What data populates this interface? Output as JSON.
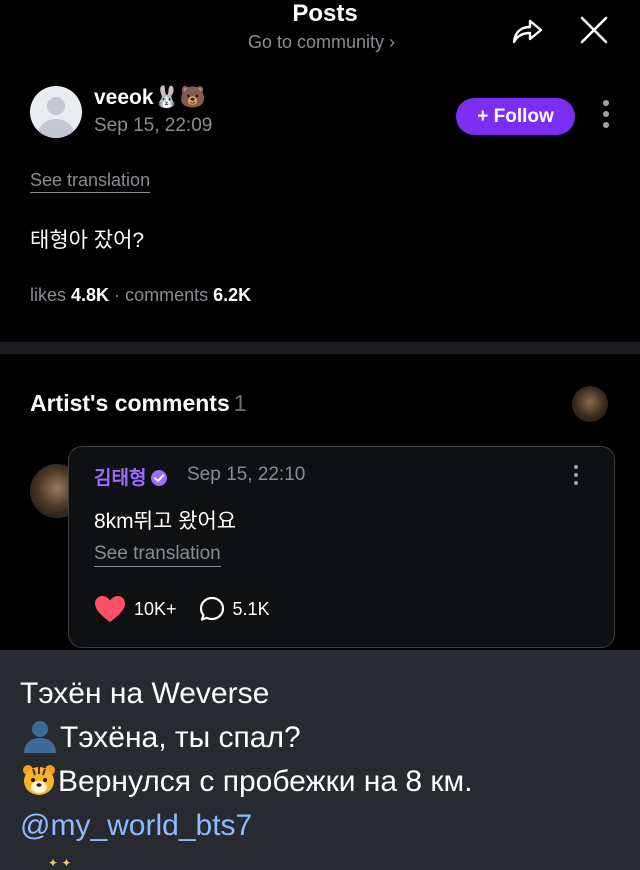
{
  "header": {
    "title": "Posts",
    "subtitle": "Go to community ›"
  },
  "post": {
    "username": "veeok🐰🐻",
    "date": "Sep 15, 22:09",
    "follow_label": "+ Follow",
    "see_translation": "See translation",
    "text": "태형아 잤어?",
    "likes_label": "likes",
    "likes_value": "4.8K",
    "separator": "·",
    "comments_label": "comments",
    "comments_value": "6.2K"
  },
  "artist_comments": {
    "title": "Artist's comments",
    "count": "1",
    "comment": {
      "author": "김태형",
      "date": "Sep 15, 22:10",
      "text": "8km뛰고 왔어요",
      "see_translation": "See translation",
      "likes": "10K+",
      "replies": "5.1K"
    }
  },
  "caption": {
    "line1": "Тэхён на Weverse",
    "line2": "Тэхёна, ты спал?",
    "line3": "Вернулся с пробежки на 8 км.",
    "mention": "@my_world_bts7"
  },
  "colors": {
    "accent": "#7b2ff2",
    "artist_name": "#9b6cff",
    "heart": "#ff4f67",
    "mention": "#8fbaff"
  }
}
